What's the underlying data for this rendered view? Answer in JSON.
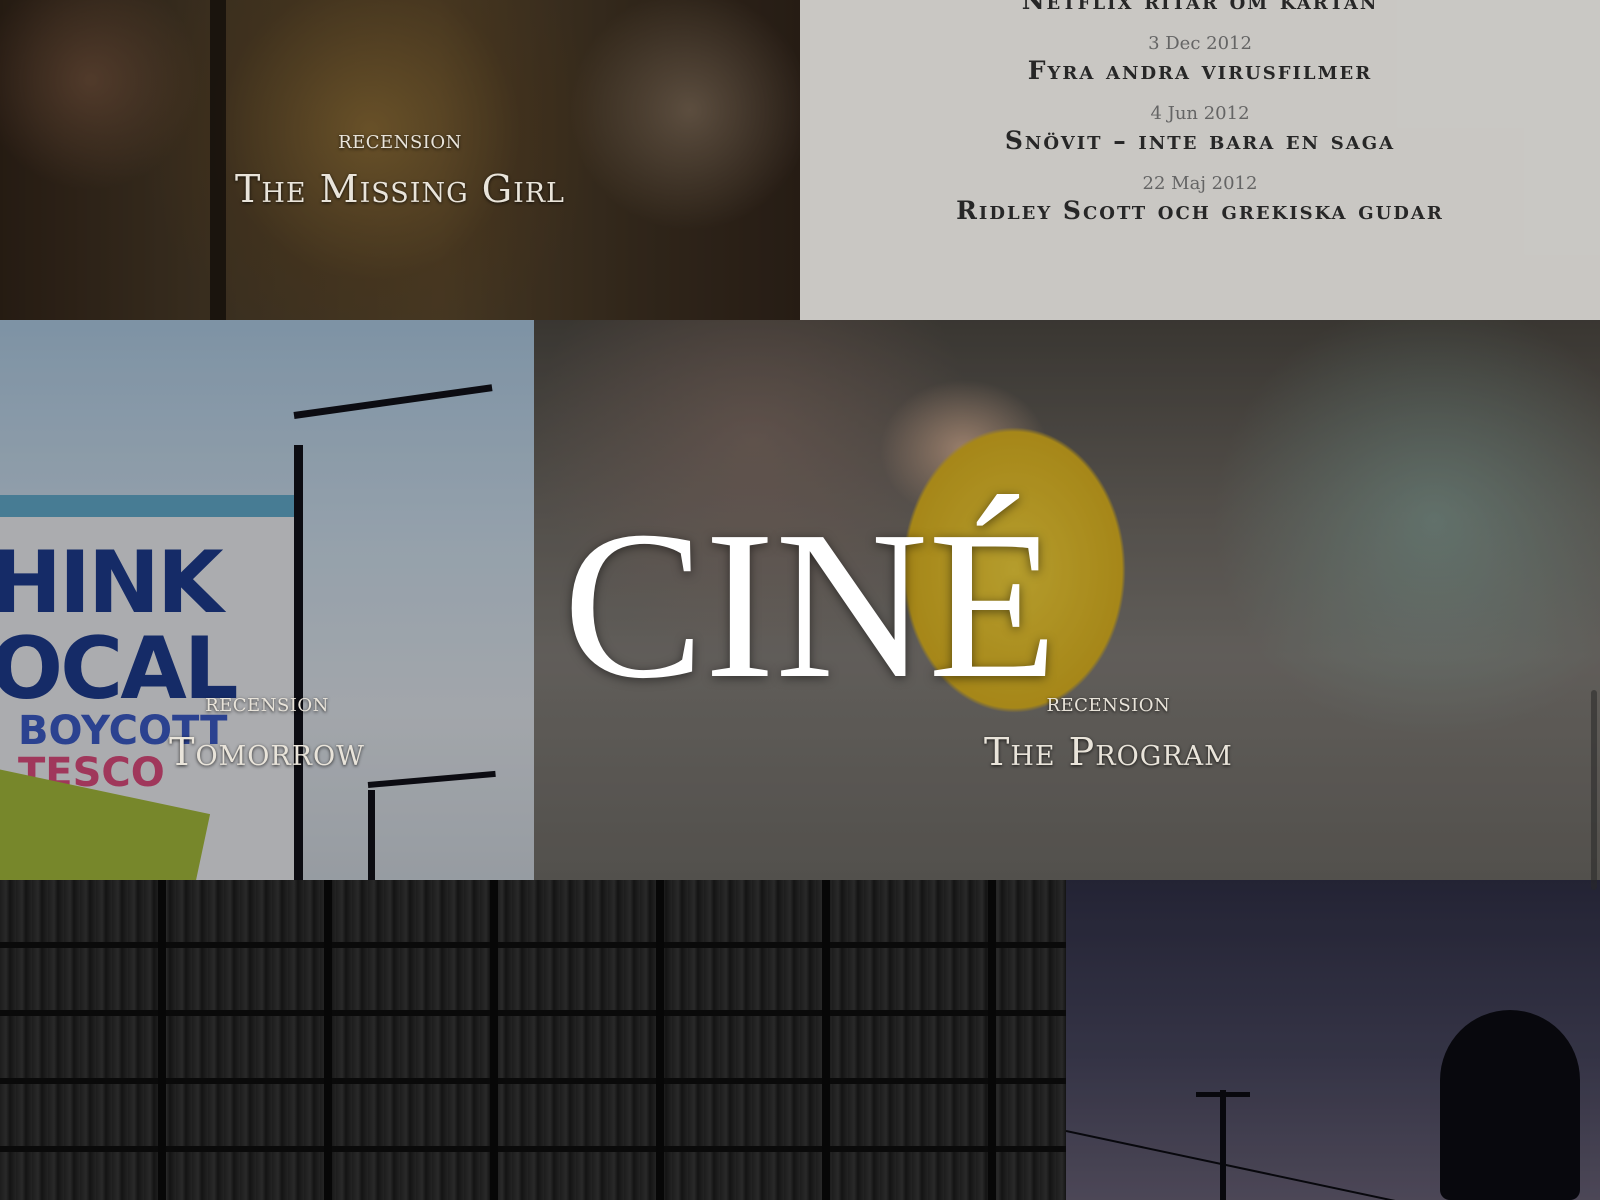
{
  "logo": "CINÉ",
  "tiles": {
    "missing_girl": {
      "kicker": "RECENSION",
      "title": "The Missing Girl"
    },
    "tomorrow": {
      "kicker": "RECENSION",
      "title": "Tomorrow"
    },
    "program": {
      "kicker": "RECENSION",
      "title": "The Program"
    }
  },
  "list": {
    "items": [
      {
        "date": "",
        "title": "Netflix ritar om kartan"
      },
      {
        "date": "3 Dec 2012",
        "title": "Fyra andra virusfilmer"
      },
      {
        "date": "4 Jun 2012",
        "title": "Snövit – inte bara en saga"
      },
      {
        "date": "22 Maj 2012",
        "title": "Ridley Scott och grekiska gudar"
      }
    ]
  },
  "tomorrow_sign": {
    "line1": "HINK",
    "line2": "OCAL",
    "line3": "BOYCOTT",
    "line4": "TESCO"
  },
  "colors": {
    "accent_text": "#e9e4da",
    "list_bg": "#d6d4d0"
  }
}
